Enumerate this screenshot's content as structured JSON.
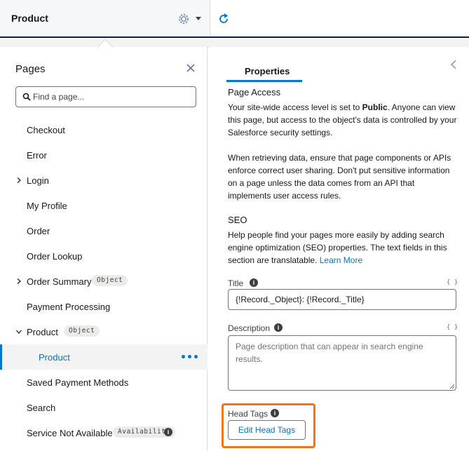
{
  "topbar": {
    "page_name": "Product",
    "gear_icon": "gear-icon",
    "caret_icon": "caret-down-icon",
    "refresh_icon": "refresh-icon"
  },
  "pages_panel": {
    "title": "Pages",
    "search_placeholder": "Find a page...",
    "items": [
      {
        "label": "Checkout",
        "chevron": "",
        "badge": ""
      },
      {
        "label": "Error",
        "chevron": "",
        "badge": ""
      },
      {
        "label": "Login",
        "chevron": ">",
        "badge": ""
      },
      {
        "label": "My Profile",
        "chevron": "",
        "badge": ""
      },
      {
        "label": "Order",
        "chevron": "",
        "badge": ""
      },
      {
        "label": "Order Lookup",
        "chevron": "",
        "badge": ""
      },
      {
        "label": "Order Summary",
        "chevron": ">",
        "badge": "Object"
      },
      {
        "label": "Payment Processing",
        "chevron": "",
        "badge": ""
      },
      {
        "label": "Product",
        "chevron": "v",
        "badge": "Object"
      },
      {
        "label": "Product",
        "chevron": "",
        "badge": "",
        "selected": true
      },
      {
        "label": "Saved Payment Methods",
        "chevron": "",
        "badge": ""
      },
      {
        "label": "Search",
        "chevron": "",
        "badge": ""
      },
      {
        "label": "Service Not Available",
        "chevron": "",
        "badge": "Availability",
        "info": true
      }
    ]
  },
  "properties": {
    "tab_label": "Properties",
    "page_access": {
      "title": "Page Access",
      "text_before": "Your site-wide access level is set to ",
      "text_bold": "Public",
      "text_after": ". Anyone can view this page, but access to the object's data is controlled by your Salesforce security settings.",
      "text2": "When retrieving data, ensure that page components or APIs enforce correct user sharing. Don't put sensitive information on a page unless the data comes from an API that implements user access rules."
    },
    "seo": {
      "title": "SEO",
      "text": "Help people find your pages more easily by adding search engine optimization (SEO) properties. The text fields in this section are translatable. ",
      "link": "Learn More"
    },
    "title_field": {
      "label": "Title",
      "value": "{!Record._Object}: {!Record._Title}"
    },
    "description_field": {
      "label": "Description",
      "placeholder": "Page description that can appear in search engine results."
    },
    "head_tags": {
      "label": "Head Tags",
      "button": "Edit Head Tags"
    },
    "brace_icon": "{ }",
    "accent_color": "#0176d3",
    "highlight_color": "#e8781b"
  }
}
